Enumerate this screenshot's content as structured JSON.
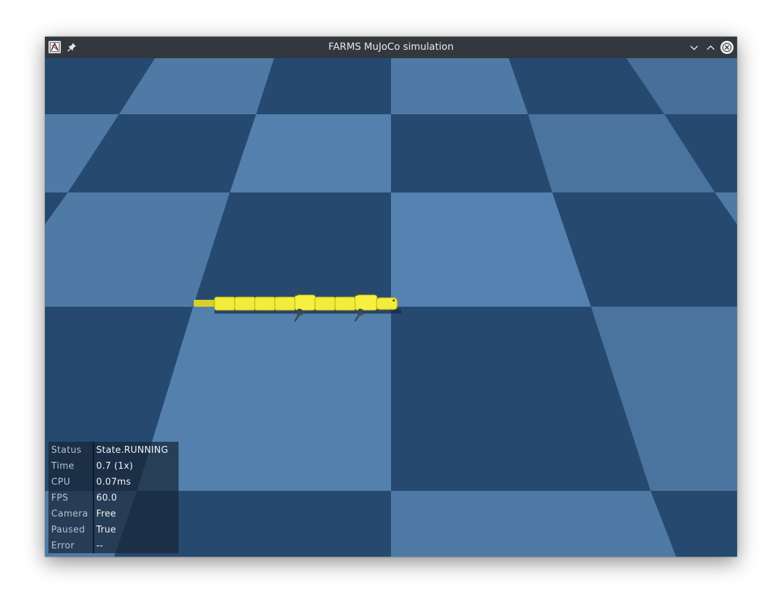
{
  "window": {
    "title": "FARMS MuJoCo simulation",
    "icons": {
      "app": "app-icon",
      "pin": "pin-icon",
      "minimize": "chevron-down-icon",
      "maximize": "chevron-up-icon",
      "close": "close-icon"
    }
  },
  "scene": {
    "floor_colors": {
      "light": "#4f7aa6",
      "dark": "#26496f"
    },
    "robot_color": "#f2ec3a"
  },
  "info_panel": {
    "rows": [
      {
        "key": "Status",
        "value": "State.RUNNING"
      },
      {
        "key": "Time",
        "value": "0.7 (1x)"
      },
      {
        "key": "CPU",
        "value": "0.07ms"
      },
      {
        "key": "FPS",
        "value": "60.0"
      },
      {
        "key": "Camera",
        "value": "Free"
      },
      {
        "key": "Paused",
        "value": "True"
      },
      {
        "key": "Error",
        "value": "--"
      }
    ]
  }
}
